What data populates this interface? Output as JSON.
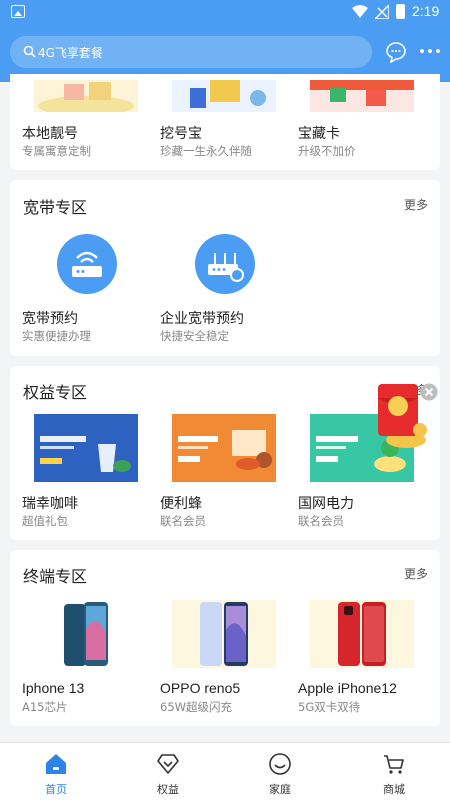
{
  "status_bar": {
    "time": "2:19"
  },
  "header": {
    "search_placeholder": "4G飞享套餐"
  },
  "top_items": [
    {
      "name": "本地靓号",
      "sub": "专属寓意定制"
    },
    {
      "name": "挖号宝",
      "sub": "珍藏一生永久伴随"
    },
    {
      "name": "宝藏卡",
      "sub": "升级不加价"
    }
  ],
  "broadband": {
    "title": "宽带专区",
    "more": "更多",
    "items": [
      {
        "name": "宽带预约",
        "sub": "实惠便捷办理"
      },
      {
        "name": "企业宽带预约",
        "sub": "快捷安全稳定"
      }
    ]
  },
  "benefits": {
    "title": "权益专区",
    "more": "更多",
    "items": [
      {
        "name": "瑞幸咖啡",
        "sub": "超值礼包"
      },
      {
        "name": "便利蜂",
        "sub": "联名会员"
      },
      {
        "name": "国网电力",
        "sub": "联名会员"
      }
    ]
  },
  "terminal": {
    "title": "终端专区",
    "more": "更多",
    "items": [
      {
        "name": "Iphone 13",
        "sub": "A15芯片"
      },
      {
        "name": "OPPO reno5",
        "sub": "65W超级闪充"
      },
      {
        "name": "Apple iPhone12",
        "sub": "5G双卡双待"
      }
    ]
  },
  "bottom_nav": [
    {
      "label": "首页",
      "active": true
    },
    {
      "label": "权益",
      "active": false
    },
    {
      "label": "家庭",
      "active": false
    },
    {
      "label": "商城",
      "active": false
    }
  ],
  "colors": {
    "brand": "#4a9df3",
    "active_tab": "#2b84ec"
  }
}
